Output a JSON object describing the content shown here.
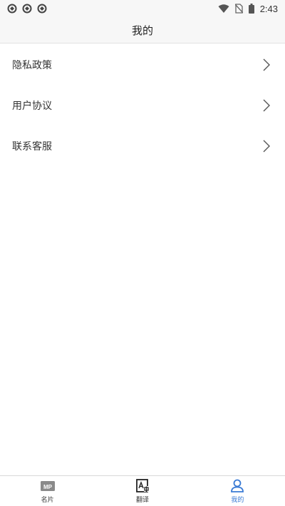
{
  "status_bar": {
    "time": "2:43",
    "left_icons": [
      "app-notification-icon",
      "app-notification-icon",
      "app-notification-icon"
    ],
    "right_icons": [
      "wifi-icon",
      "no-sim-icon",
      "battery-icon"
    ]
  },
  "header": {
    "title": "我的"
  },
  "menu": {
    "items": [
      {
        "label": "隐私政策",
        "icon": "chevron-right-icon"
      },
      {
        "label": "用户协议",
        "icon": "chevron-right-icon"
      },
      {
        "label": "联系客服",
        "icon": "chevron-right-icon"
      }
    ]
  },
  "tabbar": {
    "tabs": [
      {
        "label": "名片",
        "icon": "business-card-icon",
        "badge_text": "MP",
        "active": false
      },
      {
        "label": "翻译",
        "icon": "translate-icon",
        "active": false
      },
      {
        "label": "我的",
        "icon": "profile-icon",
        "active": true
      }
    ]
  },
  "colors": {
    "accent": "#3a7bd5",
    "header_bg": "#f7f7f7",
    "text": "#333333"
  }
}
